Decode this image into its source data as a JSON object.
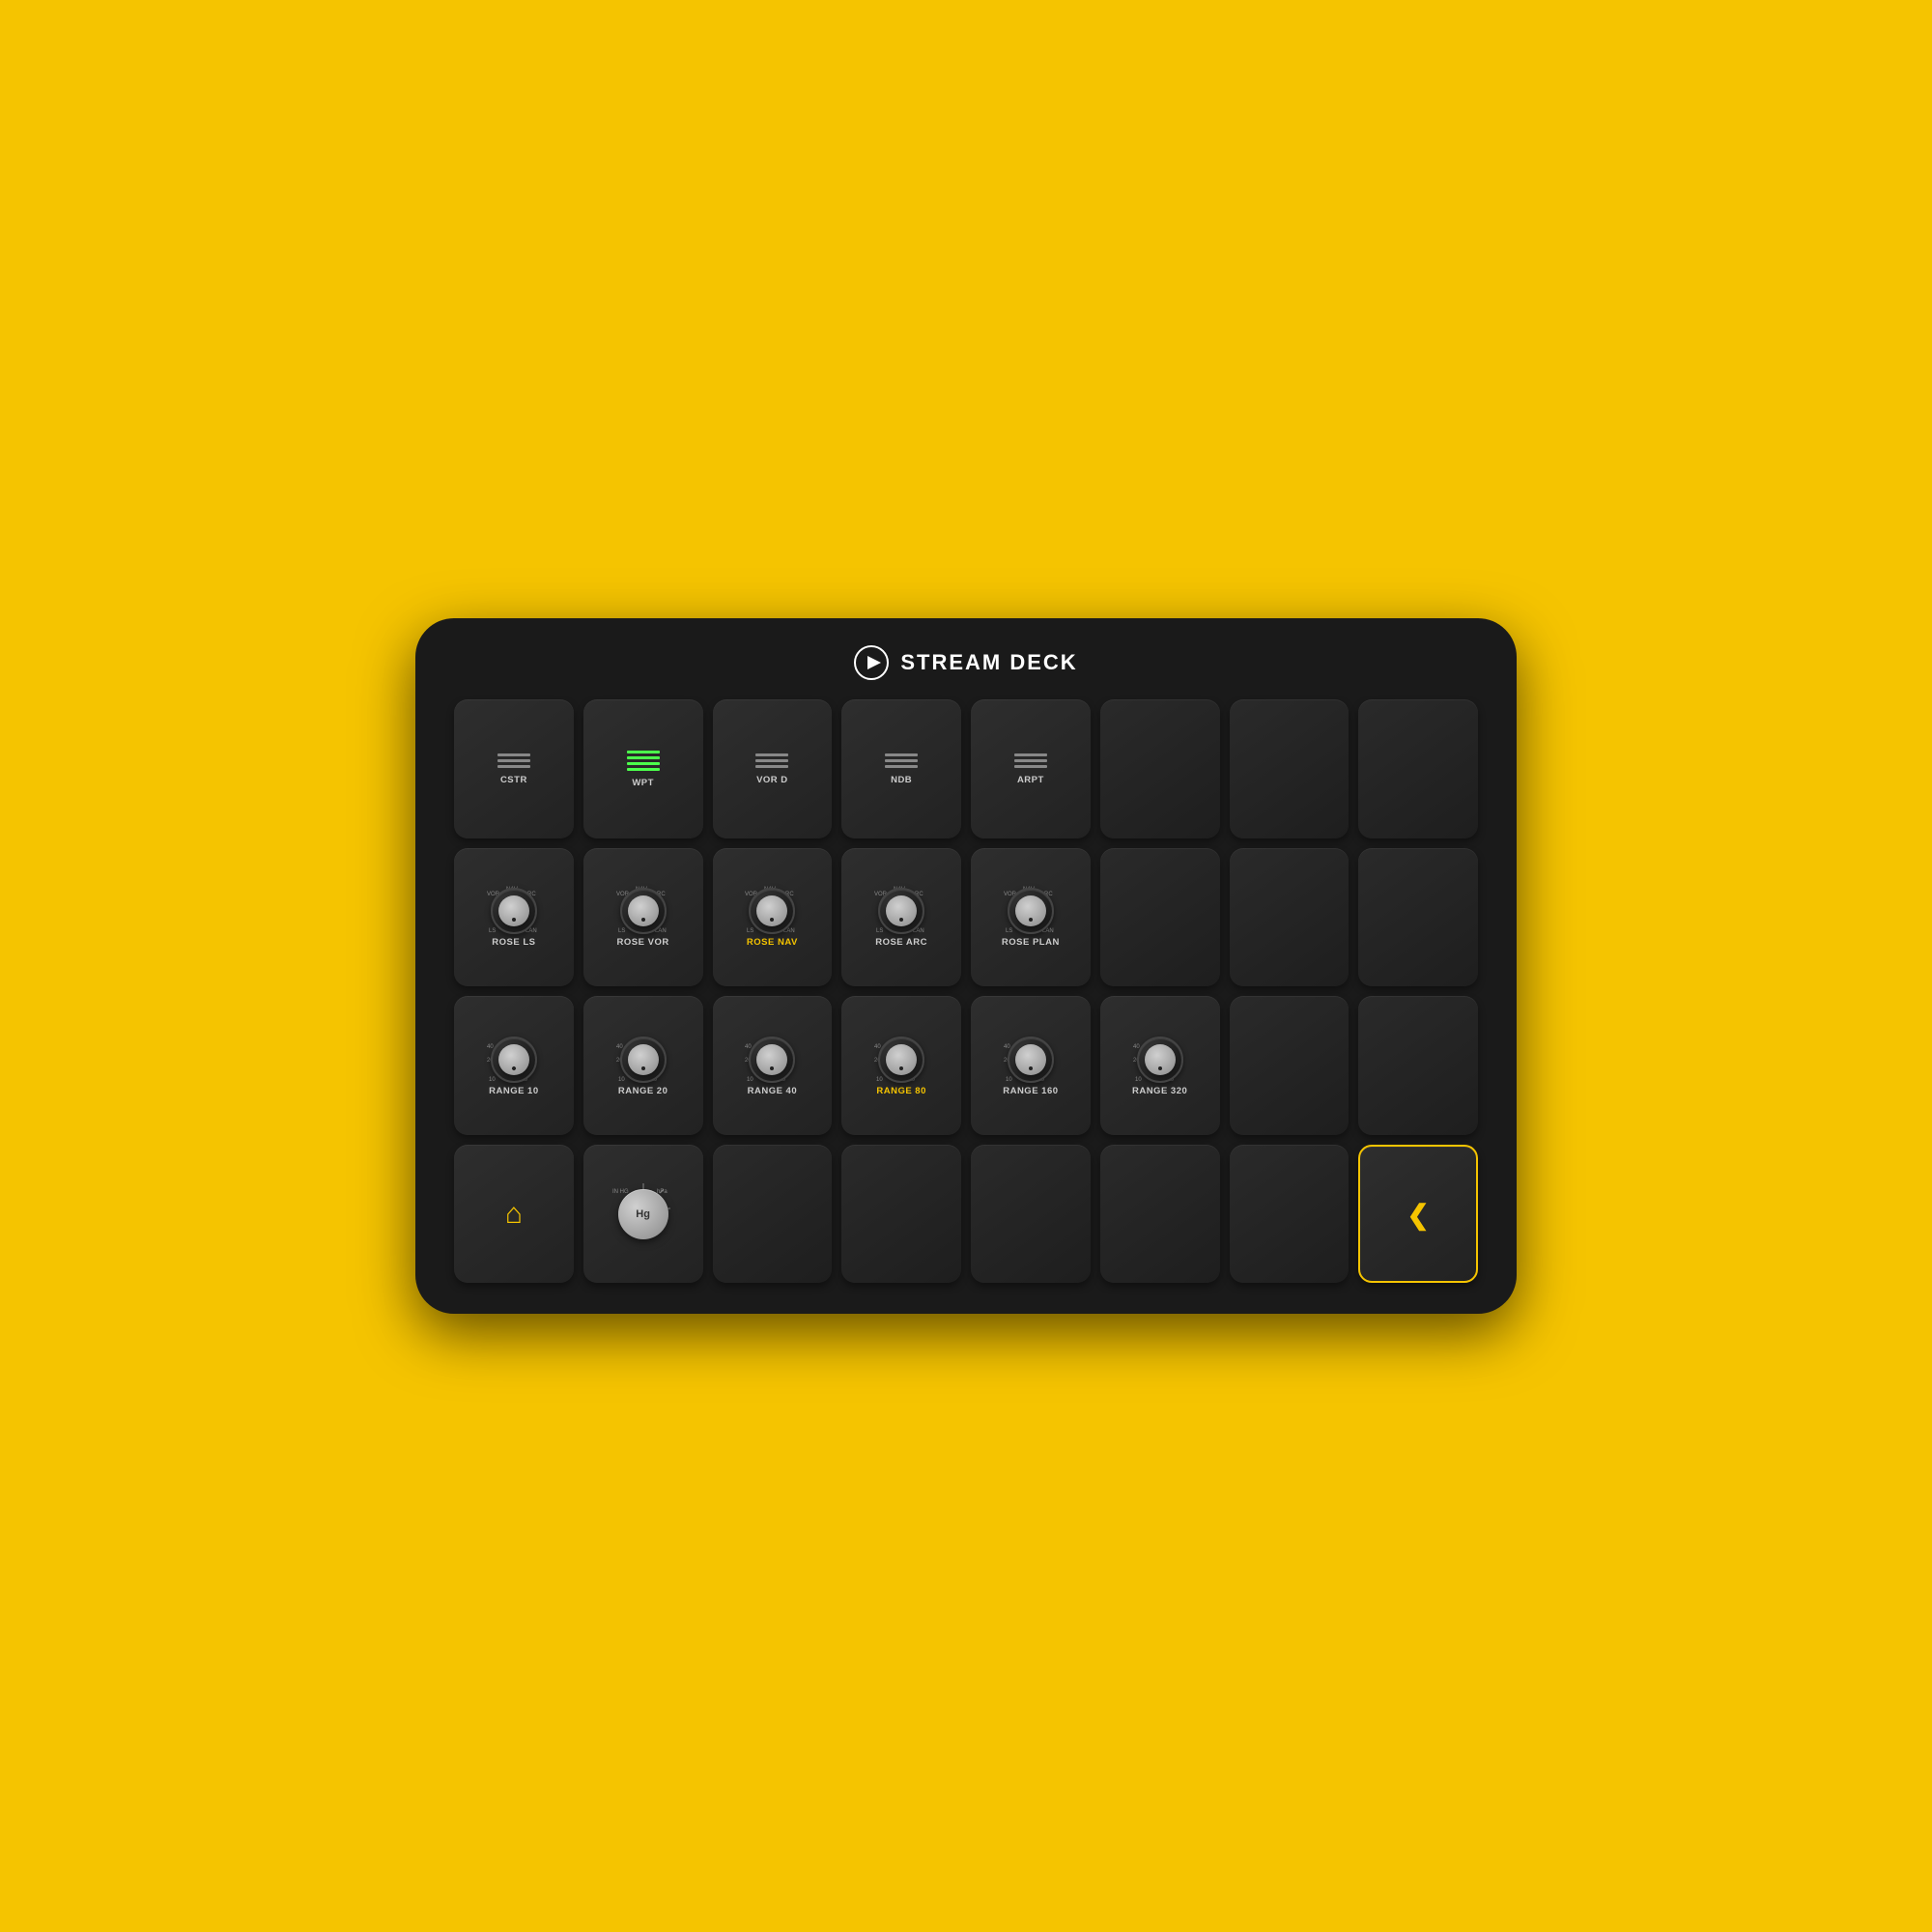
{
  "brand": {
    "name": "STREAM DECK",
    "logo_alt": "stream-deck-logo"
  },
  "grid": {
    "rows": [
      [
        {
          "id": "cstr",
          "label": "CSTR",
          "type": "lines",
          "active": false
        },
        {
          "id": "wpt",
          "label": "WPT",
          "type": "lines",
          "active": true
        },
        {
          "id": "vor_d",
          "label": "VOR D",
          "type": "lines",
          "active": false
        },
        {
          "id": "ndb",
          "label": "NDB",
          "type": "lines",
          "active": false
        },
        {
          "id": "arpt",
          "label": "ARPT",
          "type": "lines",
          "active": false
        },
        {
          "id": "empty1",
          "label": "",
          "type": "empty"
        },
        {
          "id": "empty2",
          "label": "",
          "type": "empty"
        },
        {
          "id": "empty3",
          "label": "",
          "type": "empty"
        }
      ],
      [
        {
          "id": "rose_ls",
          "label": "ROSE LS",
          "type": "knob",
          "active": false
        },
        {
          "id": "rose_vor",
          "label": "ROSE VOR",
          "type": "knob",
          "active": false
        },
        {
          "id": "rose_nav",
          "label": "ROSE NAV",
          "type": "knob",
          "active": true,
          "highlight": "yellow"
        },
        {
          "id": "rose_arc",
          "label": "ROSE ARC",
          "type": "knob",
          "active": false
        },
        {
          "id": "rose_plan",
          "label": "ROSE PLAN",
          "type": "knob",
          "active": false
        },
        {
          "id": "empty4",
          "label": "",
          "type": "empty"
        },
        {
          "id": "empty5",
          "label": "",
          "type": "empty"
        },
        {
          "id": "empty6",
          "label": "",
          "type": "empty"
        }
      ],
      [
        {
          "id": "range_10",
          "label": "RANGE 10",
          "type": "knob_range",
          "active": false
        },
        {
          "id": "range_20",
          "label": "RANGE 20",
          "type": "knob_range",
          "active": false
        },
        {
          "id": "range_40",
          "label": "RANGE 40",
          "type": "knob_range",
          "active": false
        },
        {
          "id": "range_80",
          "label": "RANGE 80",
          "type": "knob_range",
          "active": true,
          "highlight": "yellow"
        },
        {
          "id": "range_160",
          "label": "RANGE 160",
          "type": "knob_range",
          "active": false
        },
        {
          "id": "range_320",
          "label": "RANGE 320",
          "type": "knob_range",
          "active": false
        },
        {
          "id": "empty7",
          "label": "",
          "type": "empty"
        },
        {
          "id": "empty8",
          "label": "",
          "type": "empty"
        }
      ],
      [
        {
          "id": "home",
          "label": "",
          "type": "home"
        },
        {
          "id": "hg",
          "label": "Hg",
          "type": "hg"
        },
        {
          "id": "empty9",
          "label": "",
          "type": "empty"
        },
        {
          "id": "empty10",
          "label": "",
          "type": "empty"
        },
        {
          "id": "empty11",
          "label": "",
          "type": "empty"
        },
        {
          "id": "empty12",
          "label": "",
          "type": "empty"
        },
        {
          "id": "empty13",
          "label": "",
          "type": "empty"
        },
        {
          "id": "back",
          "label": "",
          "type": "back"
        }
      ]
    ]
  }
}
